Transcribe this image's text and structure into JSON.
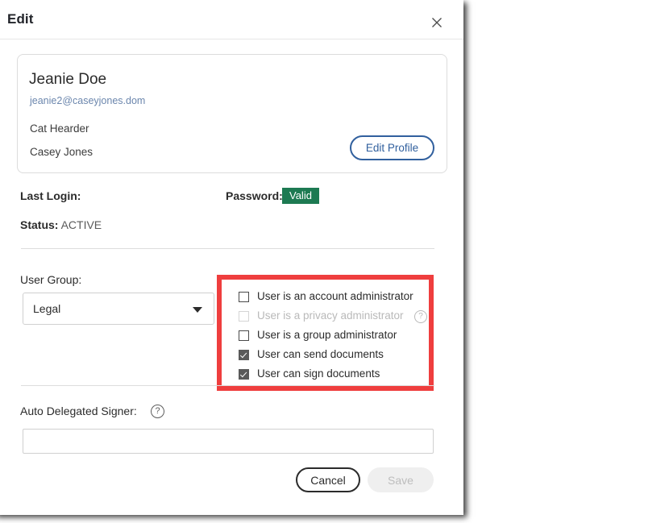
{
  "dialog": {
    "title": "Edit",
    "close_icon": "close-x-icon"
  },
  "profile": {
    "name": "Jeanie Doe",
    "email": "jeanie2@caseyjones.dom",
    "job_title": "Cat Hearder",
    "company": "Casey Jones",
    "edit_profile_label": "Edit Profile"
  },
  "meta": {
    "last_login_label": "Last Login:",
    "last_login_value": "",
    "password_label": "Password:",
    "password_status": "Valid",
    "password_status_color": "#1d7a52",
    "status_label": "Status:",
    "status_value": "ACTIVE"
  },
  "user_group": {
    "label": "User Group:",
    "selected": "Legal",
    "caret_icon": "chevron-down-icon"
  },
  "permissions": {
    "highlight_color": "#ef3e3e",
    "items": [
      {
        "label": "User is an account administrator",
        "checked": false,
        "disabled": false,
        "help": false
      },
      {
        "label": "User is a privacy administrator",
        "checked": false,
        "disabled": true,
        "help": true,
        "help_icon": "question-mark-circle-icon",
        "help_glyph": "?"
      },
      {
        "label": "User is a group administrator",
        "checked": false,
        "disabled": false,
        "help": false
      },
      {
        "label": "User can send documents",
        "checked": true,
        "disabled": false,
        "help": false
      },
      {
        "label": "User can sign documents",
        "checked": true,
        "disabled": false,
        "help": false
      }
    ]
  },
  "auto_delegated": {
    "label": "Auto Delegated Signer:",
    "help_icon": "question-mark-circle-icon",
    "help_glyph": "?",
    "value": "",
    "placeholder": ""
  },
  "footer": {
    "cancel_label": "Cancel",
    "save_label": "Save"
  }
}
